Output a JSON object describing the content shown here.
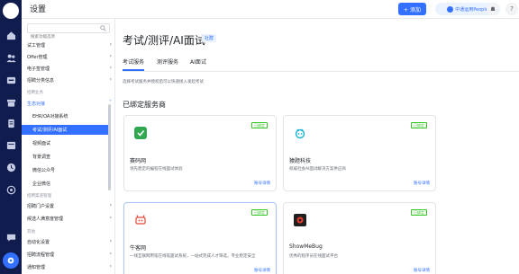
{
  "header": {
    "title": "设置",
    "add_label": "+ 添加",
    "company_label": "中通运用People"
  },
  "sidebar": {
    "search_placeholder": "搜索功能选项",
    "items": [
      {
        "label": "试工管理"
      },
      {
        "label": "Offer管理"
      },
      {
        "label": "电子签管理"
      },
      {
        "label": "招聘分类信息"
      }
    ],
    "group1": "招聘业务",
    "expanded_label": "生态对接",
    "sub_items": [
      {
        "label": "EHR/OA对接系统"
      },
      {
        "label": "考试/测评/AI面试"
      },
      {
        "label": "视频面试"
      },
      {
        "label": "背景调查"
      },
      {
        "label": "微信公众号"
      },
      {
        "label": "企业微信"
      }
    ],
    "group2": "招聘渠道管理",
    "items2": [
      {
        "label": "招聘门户设置"
      },
      {
        "label": "候选人满意度管理"
      }
    ],
    "group3": "其他",
    "items3": [
      {
        "label": "自动化设置"
      },
      {
        "label": "招聘流程管理"
      },
      {
        "label": "通知管理"
      }
    ]
  },
  "main": {
    "title": "考试/测评/AI面试",
    "badge": "社群",
    "tabs": [
      "考试服务",
      "测评服务",
      "AI面试"
    ],
    "description": "选择考试服务并授权后可以快速接入发起考试",
    "section_title": "已绑定服务商",
    "cards": [
      {
        "name": "赛码网",
        "desc": "领先稳定的编程在线面试体验",
        "tag": "已绑定",
        "action": "账号详情"
      },
      {
        "name": "猿题科技",
        "desc": "权威社会AI面试解决方案供应商",
        "tag": "已绑定",
        "action": "账号详情"
      },
      {
        "name": "牛客网",
        "desc": "一线互联网用笔在线笔面试系统，一站式完成人才筛选，专业稳定安全",
        "tag": "已绑定",
        "action": "账号详情"
      },
      {
        "name": "ShowMeBug",
        "desc": "优秀的程序员在线面试平台",
        "tag": "已绑定",
        "action": "账号详情"
      }
    ]
  },
  "colors": {
    "rail": "#0f1c4d",
    "accent": "#3370ff",
    "bound_tag": "#34c724"
  }
}
